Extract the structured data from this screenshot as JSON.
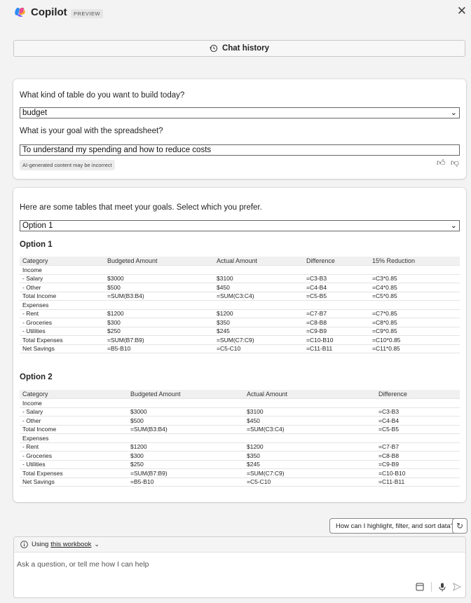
{
  "header": {
    "title": "Copilot",
    "badge": "PREVIEW",
    "close_symbol": "✕"
  },
  "chat_history": {
    "label": "Chat history"
  },
  "card1": {
    "question1": "What kind of table do you want to build today?",
    "answer1": "budget",
    "question2": "What is your goal with the spreadsheet?",
    "answer2": "To understand my spending and how to reduce costs",
    "disclaimer": "AI-generated content may be incorrect"
  },
  "card2": {
    "intro": "Here are some tables that meet your goals. Select which you prefer.",
    "selected_option": "Option 1",
    "option1": {
      "title": "Option 1",
      "headers": [
        "Category",
        "Budgeted Amount",
        "Actual Amount",
        "Difference",
        "15% Reduction"
      ],
      "rows": [
        [
          "Income",
          "",
          "",
          "",
          ""
        ],
        [
          "- Salary",
          "$3000",
          "$3100",
          "=C3-B3",
          "=C3*0.85"
        ],
        [
          "- Other",
          "$500",
          "$450",
          "=C4-B4",
          "=C4*0.85"
        ],
        [
          "Total Income",
          "=SUM(B3:B4)",
          "=SUM(C3:C4)",
          "=C5-B5",
          "=C5*0.85"
        ],
        [
          "Expenses",
          "",
          "",
          "",
          ""
        ],
        [
          "- Rent",
          "$1200",
          "$1200",
          "=C7-B7",
          "=C7*0.85"
        ],
        [
          "- Groceries",
          "$300",
          "$350",
          "=C8-B8",
          "=C8*0.85"
        ],
        [
          "- Utilities",
          "$250",
          "$245",
          "=C9-B9",
          "=C9*0.85"
        ],
        [
          "Total Expenses",
          "=SUM(B7:B9)",
          "=SUM(C7:C9)",
          "=C10-B10",
          "=C10*0.85"
        ],
        [
          "Net Savings",
          "=B5-B10",
          "=C5-C10",
          "=C11-B11",
          "=C11*0.85"
        ]
      ]
    },
    "option2": {
      "title": "Option 2",
      "headers": [
        "Category",
        "Budgeted Amount",
        "Actual Amount",
        "Difference"
      ],
      "rows": [
        [
          "Income",
          "",
          "",
          ""
        ],
        [
          "- Salary",
          "$3000",
          "$3100",
          "=C3-B3"
        ],
        [
          "- Other",
          "$500",
          "$450",
          "=C4-B4"
        ],
        [
          "Total Income",
          "=SUM(B3:B4)",
          "=SUM(C3:C4)",
          "=C5-B5"
        ],
        [
          "Expenses",
          "",
          "",
          ""
        ],
        [
          "- Rent",
          "$1200",
          "$1200",
          "=C7-B7"
        ],
        [
          "- Groceries",
          "$300",
          "$350",
          "=C8-B8"
        ],
        [
          "- Utilities",
          "$250",
          "$245",
          "=C9-B9"
        ],
        [
          "Total Expenses",
          "=SUM(B7:B9)",
          "=SUM(C7:C9)",
          "=C10-B10"
        ],
        [
          "Net Savings",
          "=B5-B10",
          "=C5-C10",
          "=C11-B11"
        ]
      ]
    }
  },
  "suggestion": {
    "label": "How can I highlight, filter, and sort data?"
  },
  "composer": {
    "context_prefix": "Using",
    "context_link": "this workbook",
    "placeholder": "Ask a question, or tell me how I can help"
  }
}
